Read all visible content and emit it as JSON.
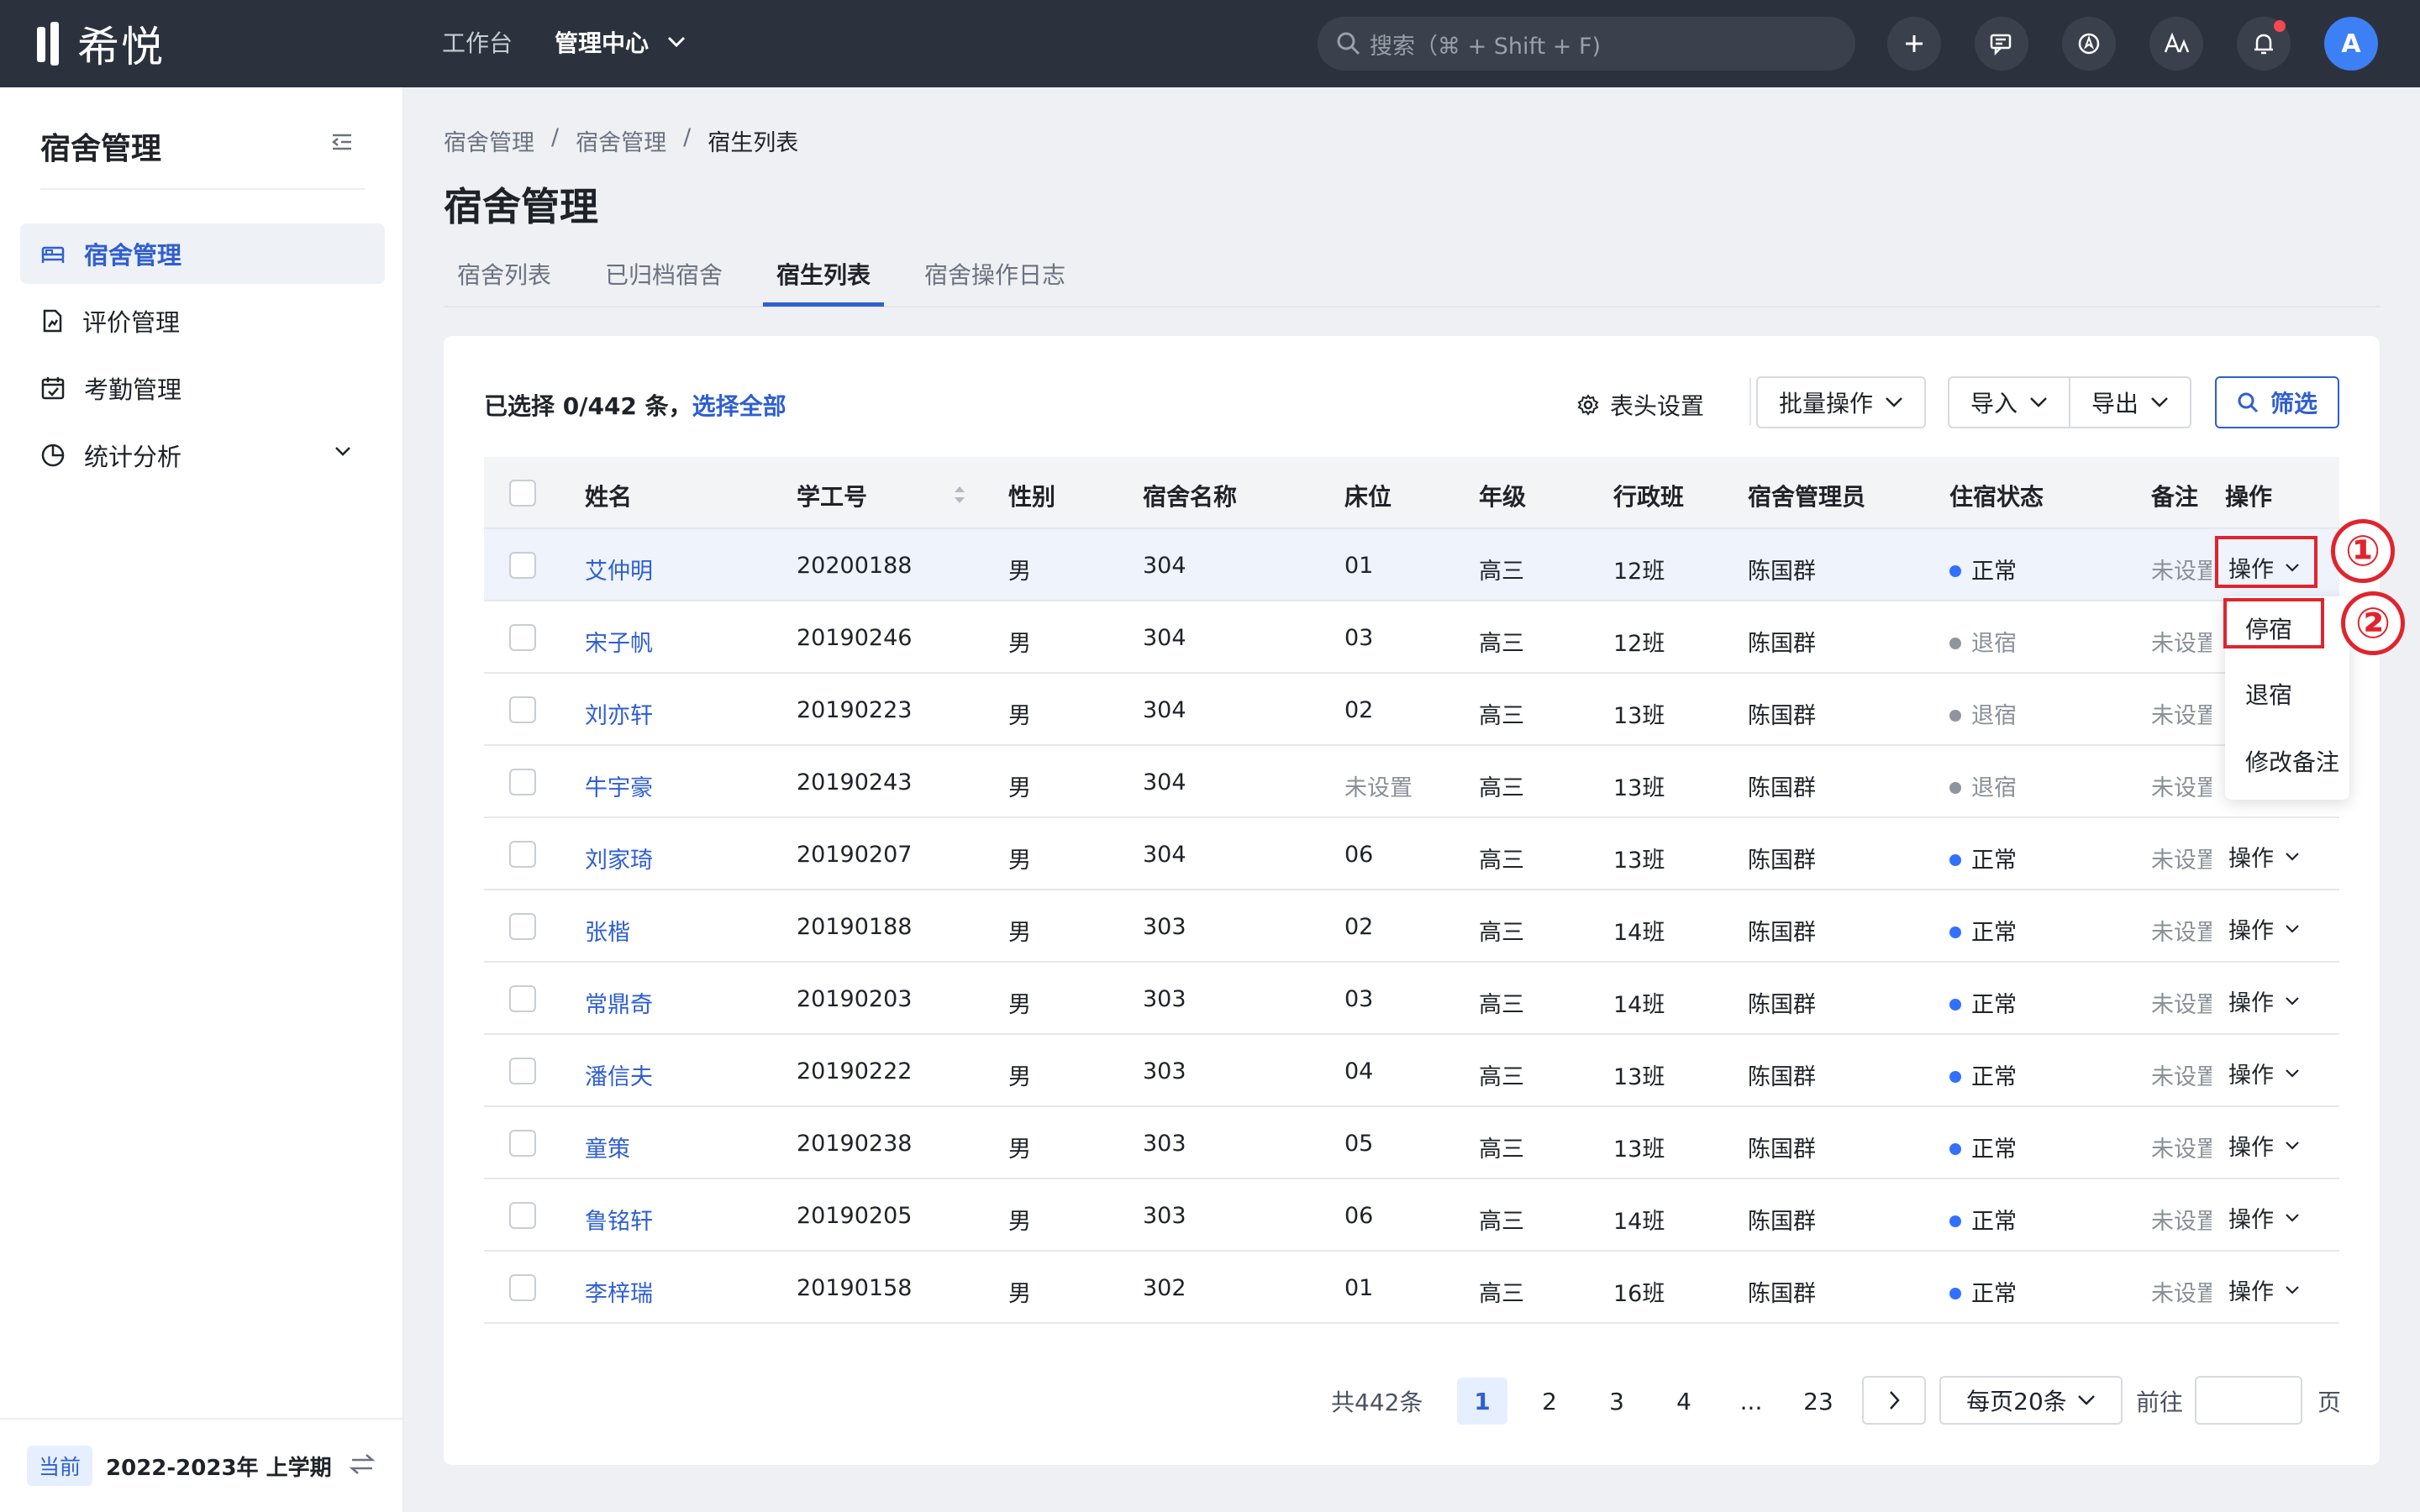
{
  "app": {
    "logo_text": "希悦"
  },
  "topnav": {
    "items": [
      "工作台"
    ],
    "active": "管理中心"
  },
  "search": {
    "placeholder": "搜索（⌘ + Shift + F)"
  },
  "toolbar_icons": [
    "plus-icon",
    "message-icon",
    "compass-icon",
    "translate-icon",
    "bell-icon"
  ],
  "user": {
    "avatar_letter": "A"
  },
  "sidebar": {
    "title": "宿舍管理",
    "items": [
      {
        "label": "宿舍管理",
        "icon": "bed-icon",
        "active": true
      },
      {
        "label": "评价管理",
        "icon": "doc-chart-icon"
      },
      {
        "label": "考勤管理",
        "icon": "calendar-check-icon"
      },
      {
        "label": "统计分析",
        "icon": "pie-chart-icon",
        "expandable": true
      }
    ],
    "footer": {
      "tag": "当前",
      "term": "2022-2023年 上学期"
    }
  },
  "breadcrumb": [
    "宿舍管理",
    "宿舍管理",
    "宿生列表"
  ],
  "breadcrumb_sep": "/",
  "page_title": "宿舍管理",
  "tabs": [
    "宿舍列表",
    "已归档宿舍",
    "宿生列表",
    "宿舍操作日志"
  ],
  "active_tab": "宿生列表",
  "selection": {
    "text": "已选择 0/442 条，",
    "select_all": "选择全部"
  },
  "actions": {
    "header_settings": "表头设置",
    "batch": "批量操作",
    "import": "导入",
    "export": "导出",
    "filter": "筛选"
  },
  "table": {
    "columns": [
      "姓名",
      "学工号",
      "性别",
      "宿舍名称",
      "床位",
      "年级",
      "行政班",
      "宿舍管理员",
      "住宿状态",
      "备注",
      "操作"
    ],
    "rows": [
      {
        "name": "艾仲明",
        "id": "20200188",
        "gender": "男",
        "dorm": "304",
        "bed": "01",
        "grade": "高三",
        "class": "12班",
        "admin": "陈国群",
        "status": "正常",
        "note": "未设置",
        "op": "操作"
      },
      {
        "name": "宋子帆",
        "id": "20190246",
        "gender": "男",
        "dorm": "304",
        "bed": "03",
        "grade": "高三",
        "class": "12班",
        "admin": "陈国群",
        "status": "退宿",
        "note": "未设置",
        "op": ""
      },
      {
        "name": "刘亦轩",
        "id": "20190223",
        "gender": "男",
        "dorm": "304",
        "bed": "02",
        "grade": "高三",
        "class": "13班",
        "admin": "陈国群",
        "status": "退宿",
        "note": "未设置",
        "op": ""
      },
      {
        "name": "牛宇豪",
        "id": "20190243",
        "gender": "男",
        "dorm": "304",
        "bed": "未设置",
        "grade": "高三",
        "class": "13班",
        "admin": "陈国群",
        "status": "退宿",
        "note": "未设置",
        "op": ""
      },
      {
        "name": "刘家琦",
        "id": "20190207",
        "gender": "男",
        "dorm": "304",
        "bed": "06",
        "grade": "高三",
        "class": "13班",
        "admin": "陈国群",
        "status": "正常",
        "note": "未设置",
        "op": "操作"
      },
      {
        "name": "张楷",
        "id": "20190188",
        "gender": "男",
        "dorm": "303",
        "bed": "02",
        "grade": "高三",
        "class": "14班",
        "admin": "陈国群",
        "status": "正常",
        "note": "未设置",
        "op": "操作"
      },
      {
        "name": "常鼎奇",
        "id": "20190203",
        "gender": "男",
        "dorm": "303",
        "bed": "03",
        "grade": "高三",
        "class": "14班",
        "admin": "陈国群",
        "status": "正常",
        "note": "未设置",
        "op": "操作"
      },
      {
        "name": "潘信夫",
        "id": "20190222",
        "gender": "男",
        "dorm": "303",
        "bed": "04",
        "grade": "高三",
        "class": "13班",
        "admin": "陈国群",
        "status": "正常",
        "note": "未设置",
        "op": "操作"
      },
      {
        "name": "童策",
        "id": "20190238",
        "gender": "男",
        "dorm": "303",
        "bed": "05",
        "grade": "高三",
        "class": "13班",
        "admin": "陈国群",
        "status": "正常",
        "note": "未设置",
        "op": "操作"
      },
      {
        "name": "鲁铭轩",
        "id": "20190205",
        "gender": "男",
        "dorm": "303",
        "bed": "06",
        "grade": "高三",
        "class": "14班",
        "admin": "陈国群",
        "status": "正常",
        "note": "未设置",
        "op": "操作"
      },
      {
        "name": "李梓瑞",
        "id": "20190158",
        "gender": "男",
        "dorm": "302",
        "bed": "01",
        "grade": "高三",
        "class": "16班",
        "admin": "陈国群",
        "status": "正常",
        "note": "未设置",
        "op": "操作"
      }
    ]
  },
  "status_colors": {
    "正常": "#3370ff",
    "退宿": "#8f959e"
  },
  "dropdown": {
    "items": [
      "停宿",
      "退宿",
      "修改备注"
    ]
  },
  "annotations": {
    "marker1": "①",
    "marker2": "②"
  },
  "pagination": {
    "total": "共442条",
    "pages": [
      "1",
      "2",
      "3",
      "4",
      "...",
      "23"
    ],
    "active_page": "1",
    "page_size": "每页20条",
    "goto_label": "前往",
    "goto_suffix": "页"
  }
}
